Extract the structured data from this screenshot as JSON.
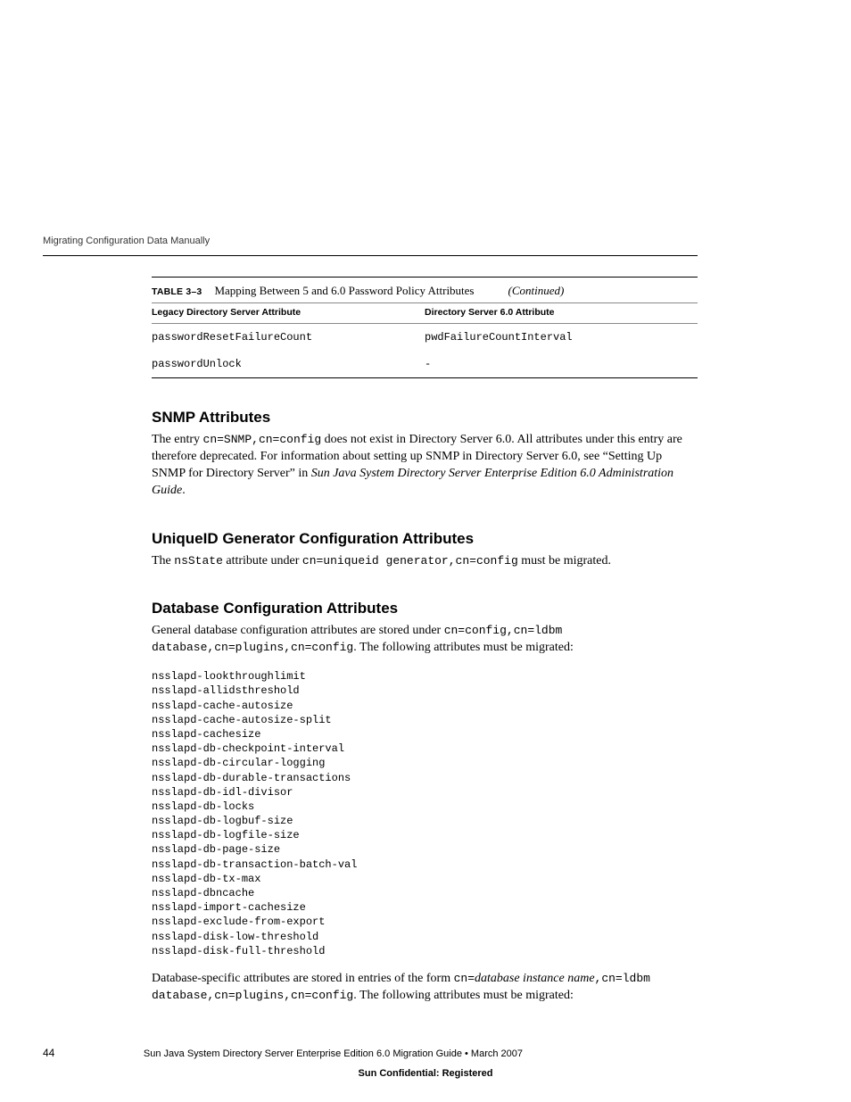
{
  "header": {
    "running_head": "Migrating Configuration Data Manually"
  },
  "table": {
    "label": "TABLE 3–3",
    "caption": "Mapping Between 5 and 6.0 Password Policy Attributes",
    "cont": "(Continued)",
    "col1_head": "Legacy Directory Server Attribute",
    "col2_head": "Directory Server 6.0 Attribute",
    "rows": [
      {
        "legacy": "passwordResetFailureCount",
        "v6": "pwdFailureCountInterval"
      },
      {
        "legacy": "passwordUnlock",
        "v6": "-"
      }
    ]
  },
  "sections": {
    "snmp": {
      "title": "SNMP Attributes",
      "p1a": "The entry ",
      "p1_code": "cn=SNMP,cn=config",
      "p1b": " does not exist in Directory Server 6.0. All attributes under this entry are therefore deprecated. For information about setting up SNMP in Directory Server 6.0, see “Setting Up SNMP for Directory Server” in ",
      "p1_ital": "Sun Java System Directory Server Enterprise Edition 6.0 Administration Guide",
      "p1c": "."
    },
    "uid": {
      "title": "UniqueID Generator Configuration Attributes",
      "p1a": "The ",
      "p1_code1": "nsState",
      "p1b": " attribute under ",
      "p1_code2": "cn=uniqueid generator,cn=config",
      "p1c": " must be migrated."
    },
    "db": {
      "title": "Database Configuration Attributes",
      "p1a": "General database configuration attributes are stored under ",
      "p1_code1": "cn=config,cn=ldbm database,cn=plugins,cn=config",
      "p1b": ". The following attributes must be migrated:",
      "attrs": "nsslapd-lookthroughlimit\nnsslapd-allidsthreshold\nnsslapd-cache-autosize\nnsslapd-cache-autosize-split\nnsslapd-cachesize\nnsslapd-db-checkpoint-interval\nnsslapd-db-circular-logging\nnsslapd-db-durable-transactions\nnsslapd-db-idl-divisor\nnsslapd-db-locks\nnsslapd-db-logbuf-size\nnsslapd-db-logfile-size\nnsslapd-db-page-size\nnsslapd-db-transaction-batch-val\nnsslapd-db-tx-max\nnsslapd-dbncache\nnsslapd-import-cachesize\nnsslapd-exclude-from-export\nnsslapd-disk-low-threshold\nnsslapd-disk-full-threshold",
      "p2a": "Database-specific attributes are stored in entries of the form ",
      "p2_code1": "cn=",
      "p2_ital": "database instance name",
      "p2_code2": ",cn=ldbm database,cn=plugins,cn=config",
      "p2b": ". The following attributes must be migrated:"
    }
  },
  "footer": {
    "page": "44",
    "book": "Sun Java System Directory Server Enterprise Edition 6.0 Migration Guide • March 2007",
    "conf": "Sun Confidential: Registered"
  }
}
